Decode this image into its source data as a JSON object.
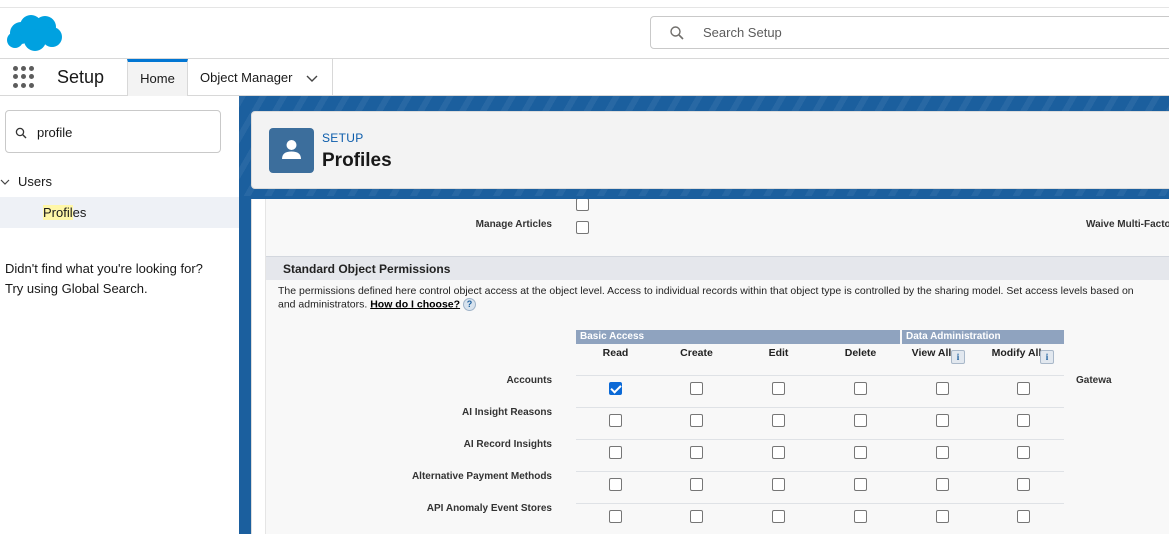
{
  "header": {
    "search_placeholder": "Search Setup",
    "logo_icon": "salesforce-cloud-icon",
    "brand_color": "#00A1E0"
  },
  "nav": {
    "app_name": "Setup",
    "tabs": [
      {
        "label": "Home"
      },
      {
        "label": "Object Manager"
      }
    ]
  },
  "sidebar": {
    "search_value": "profile",
    "tree": {
      "group": "Users",
      "item_prefix": "Profil",
      "item_suffix": "es"
    },
    "not_found_line1": "Didn't find what you're looking for?",
    "not_found_line2": "Try using Global Search."
  },
  "page": {
    "breadcrumb": "SETUP",
    "title": "Profiles"
  },
  "content": {
    "manage_articles_label": "Manage Articles",
    "waive_label": "Waive Multi-Facto",
    "section_title": "Standard Object Permissions",
    "desc_text": "The permissions defined here control object access at the object level. Access to individual records within that object type is controlled by the sharing model. Set access levels based on",
    "desc_text2": "and administrators.",
    "desc_link": "How do I choose?",
    "help_q": "?",
    "info_i": "i",
    "group_basic": "Basic Access",
    "group_admin": "Data Administration",
    "columns": [
      "Read",
      "Create",
      "Edit",
      "Delete",
      "View All",
      "Modify All"
    ],
    "gateway_label": "Gatewa",
    "rows": [
      {
        "name": "Accounts",
        "checks": [
          true,
          false,
          false,
          false,
          false,
          false
        ]
      },
      {
        "name": "AI Insight Reasons",
        "checks": [
          false,
          false,
          false,
          false,
          false,
          false
        ]
      },
      {
        "name": "AI Record Insights",
        "checks": [
          false,
          false,
          false,
          false,
          false,
          false
        ]
      },
      {
        "name": "Alternative Payment Methods",
        "checks": [
          false,
          false,
          false,
          false,
          false,
          false
        ]
      },
      {
        "name": "API Anomaly Event Stores",
        "checks": [
          false,
          false,
          false,
          false,
          false,
          false
        ]
      }
    ]
  }
}
